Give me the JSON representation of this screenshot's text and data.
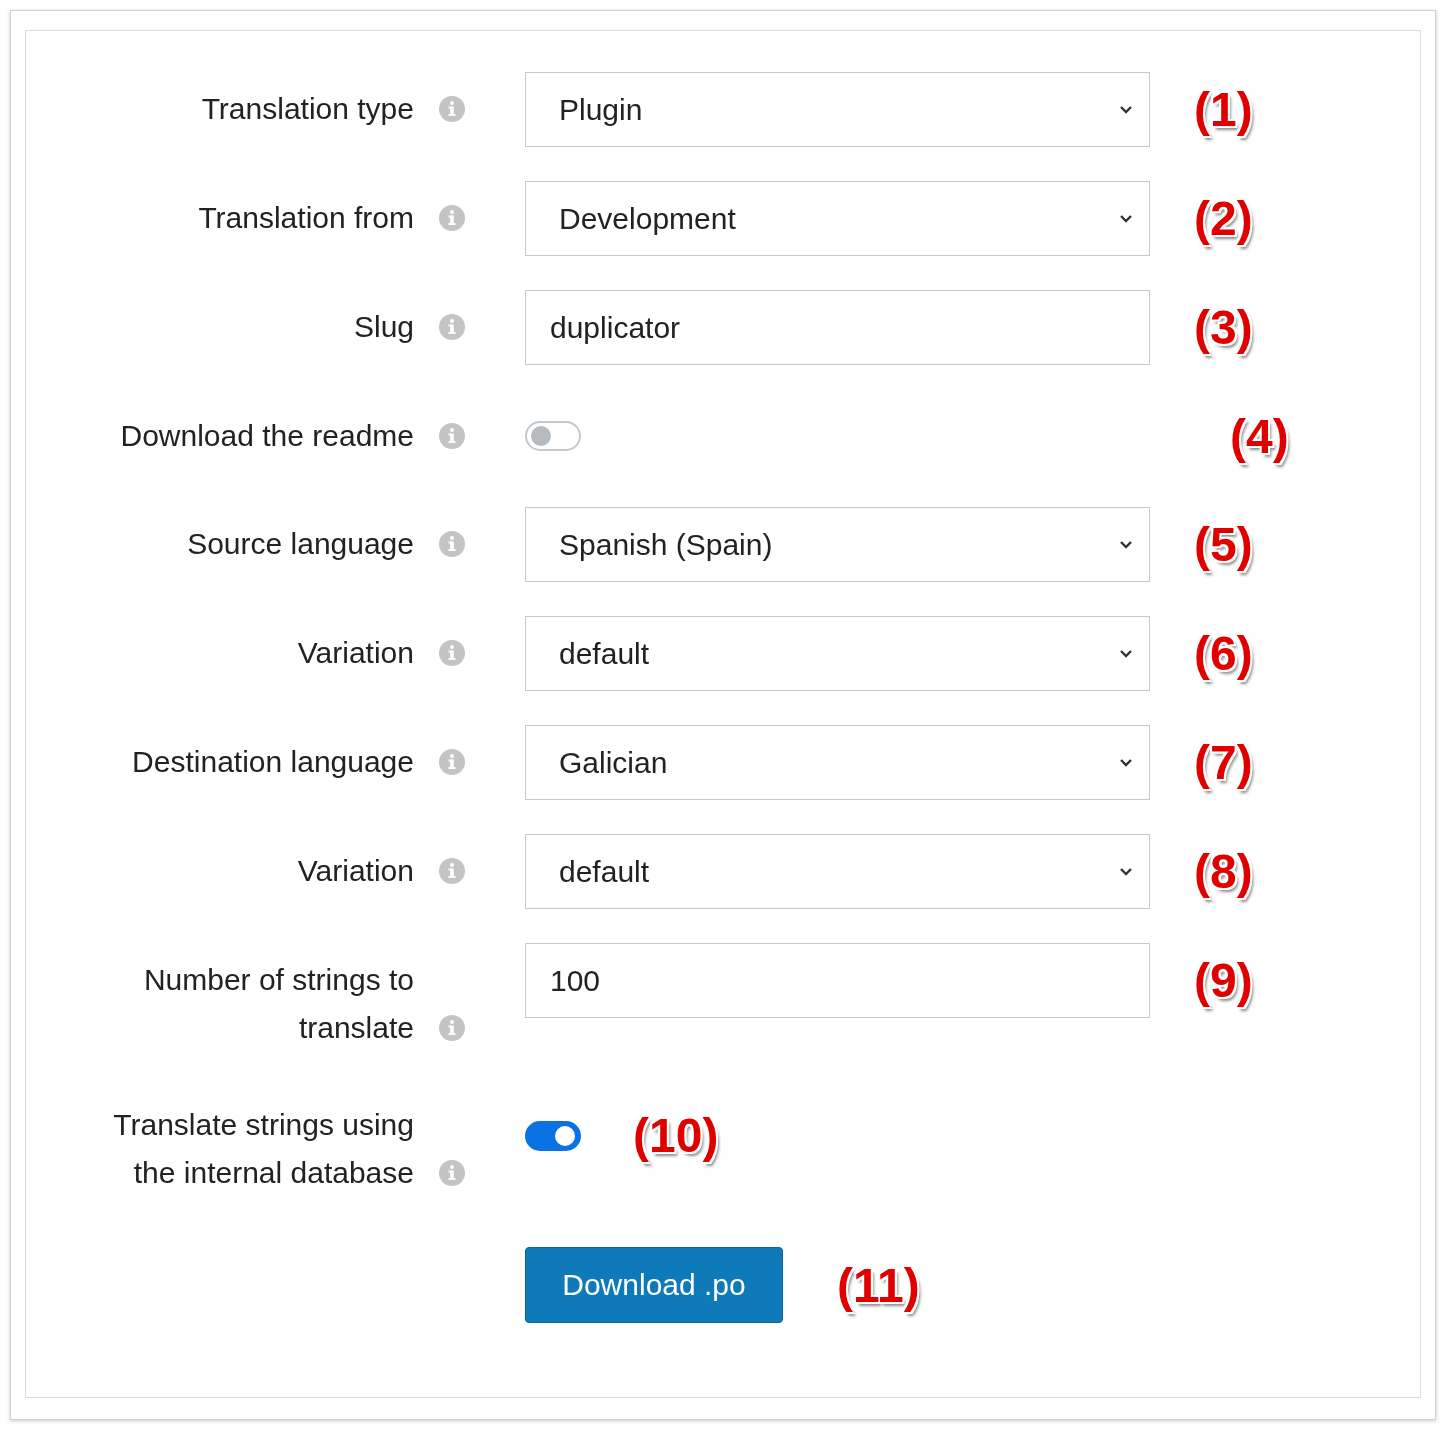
{
  "rows": [
    {
      "label": "Translation type",
      "kind": "select",
      "value": "Plugin",
      "annotation": "(1)"
    },
    {
      "label": "Translation from",
      "kind": "select",
      "value": "Development",
      "annotation": "(2)"
    },
    {
      "label": "Slug",
      "kind": "text",
      "value": "duplicator",
      "annotation": "(3)"
    },
    {
      "label": "Download the readme",
      "kind": "toggle",
      "on": false,
      "annotation": "(4)"
    },
    {
      "label": "Source language",
      "kind": "select",
      "value": "Spanish (Spain)",
      "annotation": "(5)"
    },
    {
      "label": "Variation",
      "kind": "select",
      "value": "default",
      "annotation": "(6)"
    },
    {
      "label": "Destination language",
      "kind": "select",
      "value": "Galician",
      "annotation": "(7)"
    },
    {
      "label": "Variation",
      "kind": "select",
      "value": "default",
      "annotation": "(8)"
    },
    {
      "label": "Number of strings to translate",
      "kind": "text",
      "value": "100",
      "annotation": "(9)"
    },
    {
      "label": "Translate strings using the internal database",
      "kind": "toggle",
      "on": true,
      "annotation": "(10)"
    }
  ],
  "button": {
    "label": "Download .po",
    "annotation": "(11)"
  }
}
